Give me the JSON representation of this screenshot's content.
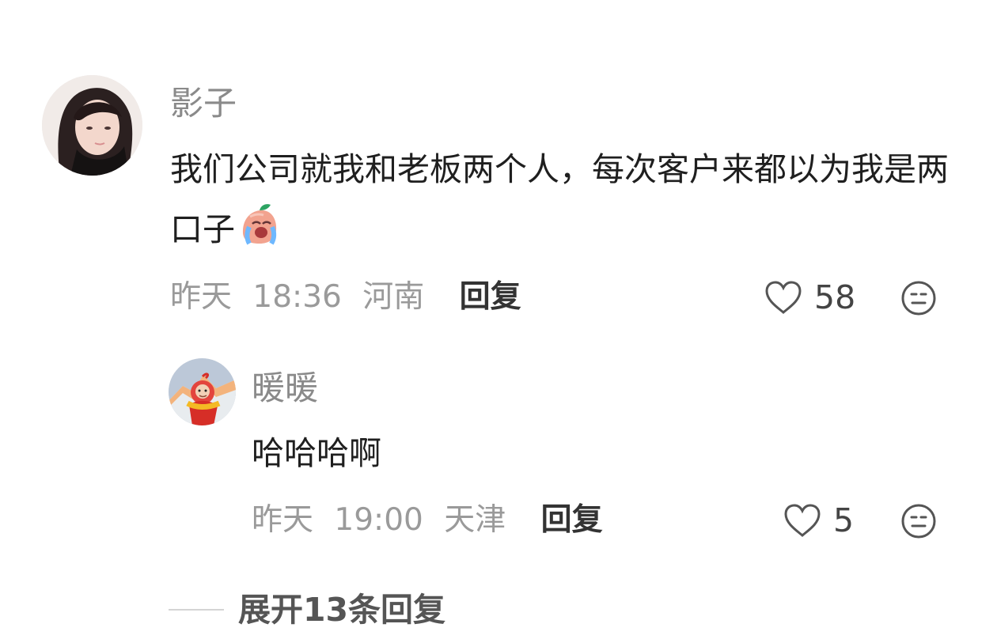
{
  "comment": {
    "username": "影子",
    "text": "我们公司就我和老板两个人，每次客户来都以为我是两口子",
    "emoji": "crying-laughing-peach-emoji",
    "date": "昨天",
    "time": "18:36",
    "location": "河南",
    "reply_label": "回复",
    "likes": "58"
  },
  "reply": {
    "username": "暖暖",
    "text": "哈哈哈啊",
    "date": "昨天",
    "time": "19:00",
    "location": "天津",
    "reply_label": "回复",
    "likes": "5"
  },
  "expand": {
    "label": "展开13条回复"
  },
  "icons": {
    "like": "heart-outline-icon",
    "react": "neutral-face-icon"
  },
  "colors": {
    "username": "#8a8a8a",
    "meta": "#9a9a9a",
    "text": "#1f1f1f",
    "action": "#333333"
  }
}
